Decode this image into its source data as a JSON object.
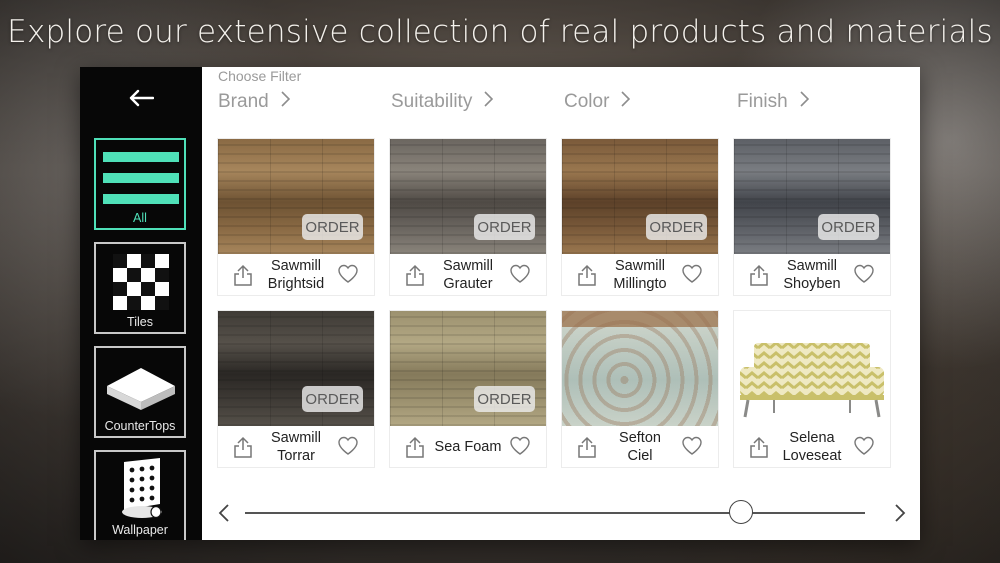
{
  "headline": "Explore our extensive collection of real products and materials",
  "sidebar": {
    "back_icon": "arrow-left-icon",
    "categories": [
      {
        "label": "All",
        "icon": "list-lines-icon",
        "active": true
      },
      {
        "label": "Tiles",
        "icon": "checkerboard-icon",
        "active": false
      },
      {
        "label": "CounterTops",
        "icon": "slab-icon",
        "active": false
      },
      {
        "label": "Wallpaper",
        "icon": "wallpaper-roll-icon",
        "active": false
      }
    ]
  },
  "filters": {
    "caption": "Choose Filter",
    "items": [
      {
        "label": "Brand"
      },
      {
        "label": "Suitability"
      },
      {
        "label": "Color"
      },
      {
        "label": "Finish"
      }
    ]
  },
  "order_label": "ORDER",
  "products": [
    {
      "line1": "Sawmill",
      "line2": "Brightsid",
      "orderable": true,
      "texture": "wood",
      "colors": [
        "#8a6a44",
        "#6d5233",
        "#a7865c"
      ]
    },
    {
      "line1": "Sawmill",
      "line2": "Grauter",
      "orderable": true,
      "texture": "wood",
      "colors": [
        "#6b6660",
        "#4f4a45",
        "#8a847b"
      ]
    },
    {
      "line1": "Sawmill",
      "line2": "Millingto",
      "orderable": true,
      "texture": "wood",
      "colors": [
        "#7a5a3a",
        "#5c4129",
        "#9a774f"
      ]
    },
    {
      "line1": "Sawmill",
      "line2": "Shoyben",
      "orderable": true,
      "texture": "wood",
      "colors": [
        "#5d6066",
        "#41444a",
        "#7a7d82"
      ]
    },
    {
      "line1": "Sawmill",
      "line2": "Torrar",
      "orderable": true,
      "texture": "wood",
      "colors": [
        "#3f3b36",
        "#2a2724",
        "#56514a"
      ]
    },
    {
      "line1": "Sea Foam",
      "line2": "",
      "orderable": true,
      "texture": "wood",
      "colors": [
        "#9c916f",
        "#857a5b",
        "#b3a884"
      ]
    },
    {
      "line1": "Sefton",
      "line2": "Ciel",
      "orderable": false,
      "texture": "rug",
      "colors": [
        "#aebfb8",
        "#a88b6c",
        "#c9d2c8"
      ]
    },
    {
      "line1": "Selena",
      "line2": "Loveseat",
      "orderable": false,
      "texture": "sofa",
      "colors": [
        "#c9c06a",
        "#efe9c2",
        "#8a8a88"
      ]
    }
  ],
  "slider": {
    "value": 0.8,
    "prev_icon": "chevron-left-icon",
    "next_icon": "chevron-right-icon"
  }
}
